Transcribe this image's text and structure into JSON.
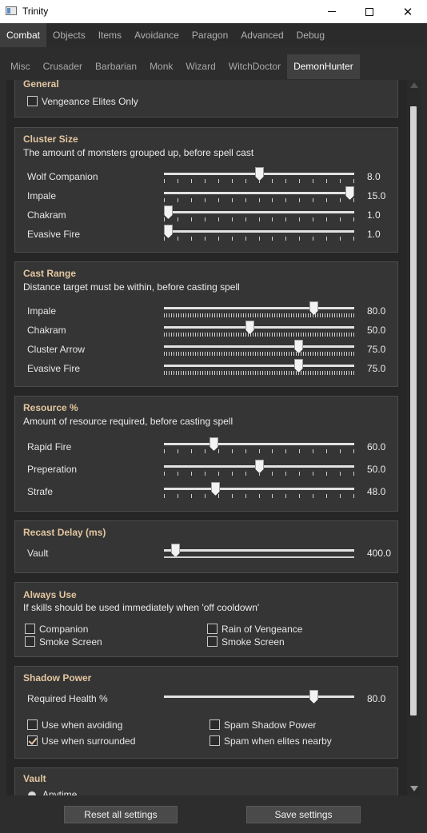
{
  "window": {
    "title": "Trinity"
  },
  "main_tabs": [
    "Combat",
    "Objects",
    "Items",
    "Avoidance",
    "Paragon",
    "Advanced",
    "Debug"
  ],
  "sub_tabs": [
    "Misc",
    "Crusader",
    "Barbarian",
    "Monk",
    "Wizard",
    "WitchDoctor",
    "DemonHunter"
  ],
  "general": {
    "title": "General",
    "vengeance_label": "Vengeance Elites Only"
  },
  "cluster": {
    "title": "Cluster Size",
    "desc": "The amount of monsters grouped up, before spell cast",
    "rows": [
      {
        "label": "Wolf Companion",
        "value": "8.0",
        "fraction": 0.5
      },
      {
        "label": "Impale",
        "value": "15.0",
        "fraction": 1.0
      },
      {
        "label": "Chakram",
        "value": "1.0",
        "fraction": 0.0
      },
      {
        "label": "Evasive Fire",
        "value": "1.0",
        "fraction": 0.0
      }
    ]
  },
  "cast": {
    "title": "Cast Range",
    "desc": "Distance target must be within, before casting spell",
    "rows": [
      {
        "label": "Impale",
        "value": "80.0",
        "fraction": 0.8
      },
      {
        "label": "Chakram",
        "value": "50.0",
        "fraction": 0.45
      },
      {
        "label": "Cluster Arrow",
        "value": "75.0",
        "fraction": 0.72
      },
      {
        "label": "Evasive Fire",
        "value": "75.0",
        "fraction": 0.72
      }
    ]
  },
  "resource": {
    "title": "Resource %",
    "desc": "Amount of resource required, before casting spell",
    "rows": [
      {
        "label": "Rapid Fire",
        "value": "60.0",
        "fraction": 0.25
      },
      {
        "label": "Preperation",
        "value": "50.0",
        "fraction": 0.5
      },
      {
        "label": "Strafe",
        "value": "48.0",
        "fraction": 0.26
      }
    ]
  },
  "recast": {
    "title": "Recast Delay (ms)",
    "rows": [
      {
        "label": "Vault",
        "value": "400.0",
        "fraction": 0.04
      }
    ]
  },
  "always": {
    "title": "Always Use",
    "desc": "If skills should be used immediately when 'off cooldown'",
    "left": [
      "Companion",
      "Smoke Screen"
    ],
    "right": [
      "Rain of Vengeance",
      "Smoke Screen"
    ]
  },
  "shadow": {
    "title": "Shadow Power",
    "health_label": "Required Health %",
    "health_value": "80.0",
    "health_fraction": 0.8,
    "checks": [
      {
        "label": "Use when avoiding",
        "checked": false
      },
      {
        "label": "Use when surrounded",
        "checked": true
      },
      {
        "label": "Spam Shadow Power",
        "checked": false
      },
      {
        "label": "Spam when elites nearby",
        "checked": false
      }
    ]
  },
  "vault": {
    "title": "Vault",
    "radio_label": "Anytime"
  },
  "footer": {
    "reset_label": "Reset all settings",
    "save_label": "Save settings"
  },
  "colors": {
    "accent": "#e3c6a0",
    "background": "#2d2d2d",
    "panel": "#353535"
  }
}
